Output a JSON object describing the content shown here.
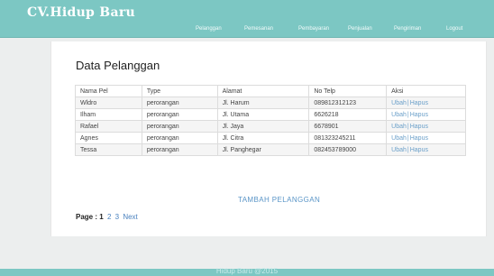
{
  "header": {
    "brand": "CV.Hidup Baru",
    "nav": [
      "Pelanggan",
      "Pemesanan",
      "Pembayaran",
      "Penjualan",
      "Pengiriman",
      "Logout"
    ]
  },
  "main": {
    "title": "Data Pelanggan",
    "table": {
      "headers": [
        "Nama Pel",
        "Type",
        "Alamat",
        "No Telp",
        "Aksi"
      ],
      "rows": [
        {
          "nama": "Wldro",
          "type": "perorangan",
          "alamat": "Jl. Harum",
          "telp": "089812312123"
        },
        {
          "nama": "Ilham",
          "type": "perorangan",
          "alamat": "Jl. Utama",
          "telp": "6626218"
        },
        {
          "nama": "Rafael",
          "type": "perorangan",
          "alamat": "Jl. Jaya",
          "telp": "6678901"
        },
        {
          "nama": "Agnes",
          "type": "perorangan",
          "alamat": "Jl. Citra",
          "telp": "081323245211"
        },
        {
          "nama": "Tessa",
          "type": "perorangan",
          "alamat": "Jl. Panghegar",
          "telp": "082453789000"
        }
      ],
      "edit_label": "Ubah",
      "separator": "|",
      "delete_label": "Hapus"
    },
    "add_label": "TAMBAH PELANGGAN",
    "pager": {
      "label": "Page :",
      "current": "1",
      "pages": [
        "2",
        "3"
      ],
      "next": "Next"
    }
  },
  "footer": {
    "text": "Hidup Baru @2015"
  }
}
